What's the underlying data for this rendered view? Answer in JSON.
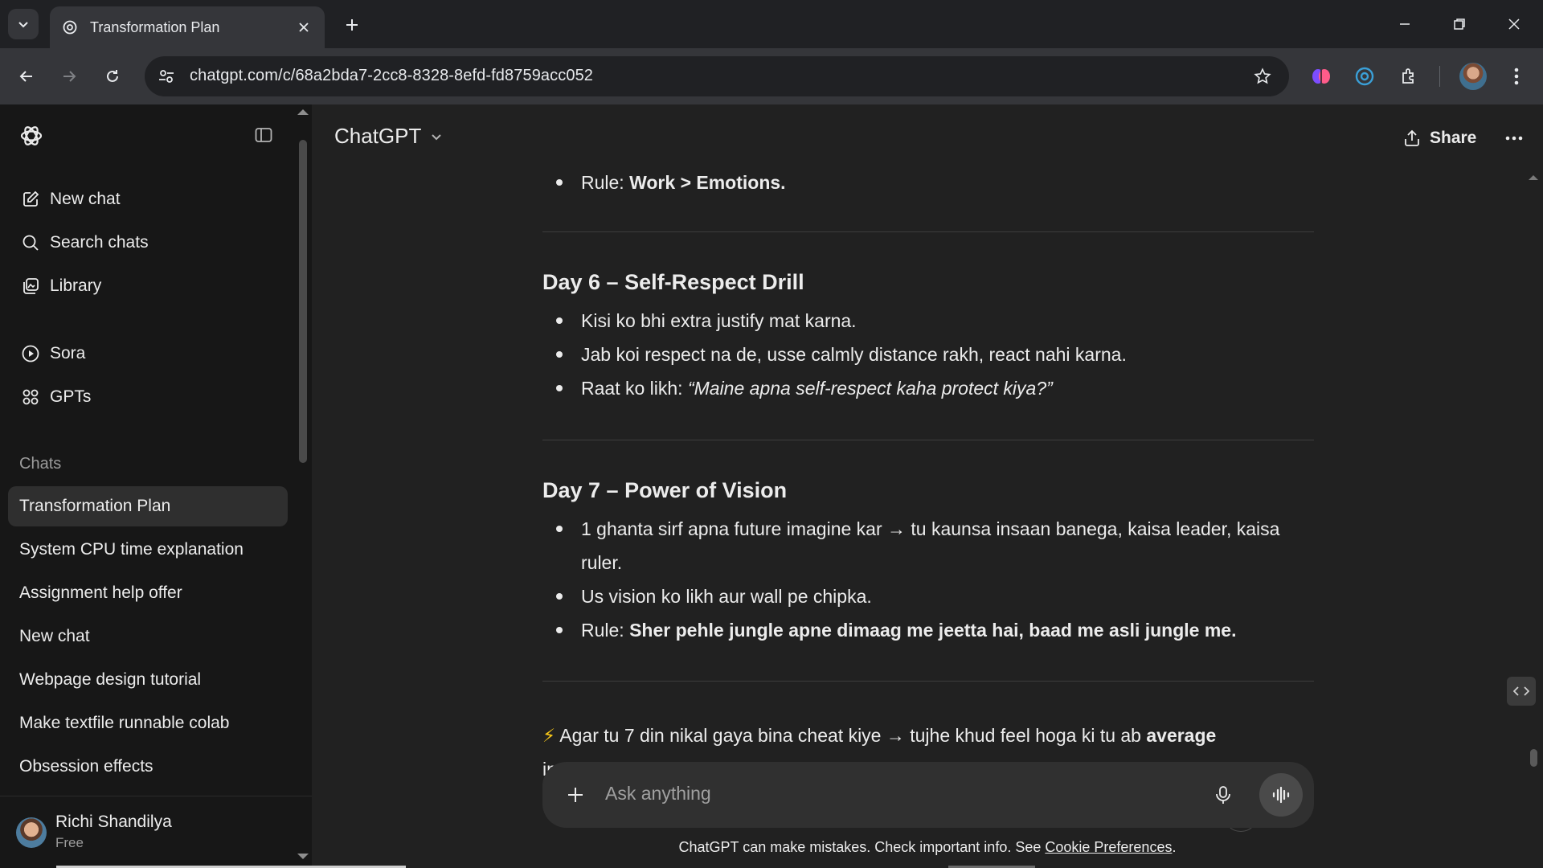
{
  "browser": {
    "tab_title": "Transformation Plan",
    "url": "chatgpt.com/c/68a2bda7-2cc8-8328-8efd-fd8759acc052"
  },
  "sidebar": {
    "top_items": [
      {
        "label": "New chat",
        "icon": "edit-icon"
      },
      {
        "label": "Search chats",
        "icon": "search-icon"
      },
      {
        "label": "Library",
        "icon": "library-icon"
      }
    ],
    "mid_items": [
      {
        "label": "Sora",
        "icon": "play-circle-icon"
      },
      {
        "label": "GPTs",
        "icon": "grid-icon"
      }
    ],
    "section_label": "Chats",
    "chats": [
      "Transformation Plan",
      "System CPU time explanation",
      "Assignment help offer",
      "New chat",
      "Webpage design tutorial",
      "Make textfile runnable colab",
      "Obsession effects"
    ],
    "user": {
      "name": "Richi Shandilya",
      "plan": "Free"
    }
  },
  "header": {
    "model": "ChatGPT",
    "share_label": "Share"
  },
  "content": {
    "prev_rule": {
      "prefix": "Rule: ",
      "bold": "Work > Emotions."
    },
    "day6": {
      "heading": "Day 6 – Self-Respect Drill",
      "b1": "Kisi ko bhi extra justify mat karna.",
      "b2": "Jab koi respect na de, usse calmly distance rakh, react nahi karna.",
      "b3_prefix": "Raat ko likh: ",
      "b3_italic": "“Maine apna self-respect kaha protect kiya?”"
    },
    "day7": {
      "heading": "Day 7 – Power of Vision",
      "b1": "1 ghanta sirf apna future imagine kar → tu kaunsa insaan banega, kaisa leader, kaisa ruler.",
      "b2": "Us vision ko likh aur wall pe chipka.",
      "b3_prefix": "Rule: ",
      "b3_bold": "Sher pehle jungle apne dimaag me jeetta hai, baad me asli jungle me."
    },
    "final_emoji": "⚡",
    "final_text": " Agar tu 7 din nikal gaya bina cheat kiye → tujhe khud feel hoga ki tu ab ",
    "final_bold": "average",
    "final_cut": "in"
  },
  "composer": {
    "placeholder": "Ask anything",
    "disclaimer": "ChatGPT can make mistakes. Check important info. See ",
    "disclaimer_link": "Cookie Preferences",
    "disclaimer_end": "."
  }
}
